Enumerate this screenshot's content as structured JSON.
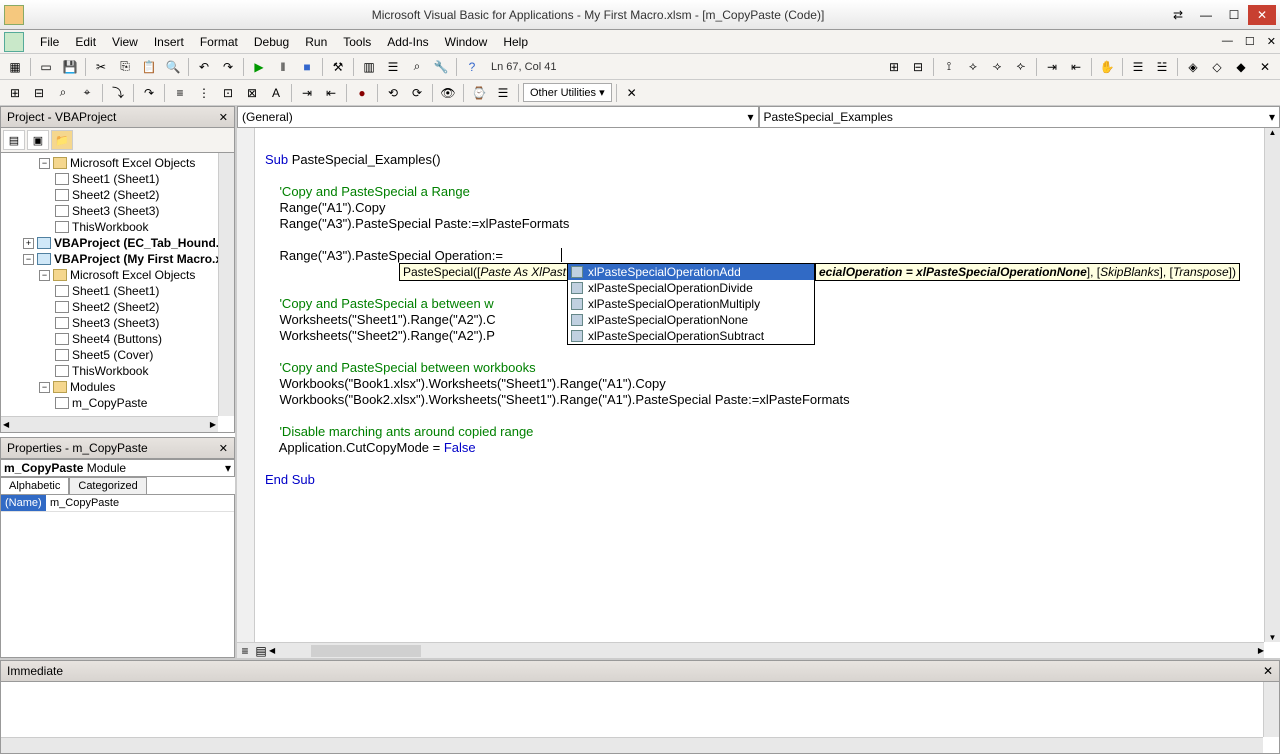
{
  "title": "Microsoft Visual Basic for Applications - My First Macro.xlsm - [m_CopyPaste (Code)]",
  "menu": [
    "File",
    "Edit",
    "View",
    "Insert",
    "Format",
    "Debug",
    "Run",
    "Tools",
    "Add-Ins",
    "Window",
    "Help"
  ],
  "status_line": "Ln 67, Col 41",
  "other_utilities": "Other Utilities",
  "project_panel_title": "Project - VBAProject",
  "tree": {
    "excel_objects": "Microsoft Excel Objects",
    "sheet1": "Sheet1 (Sheet1)",
    "sheet2": "Sheet2 (Sheet2)",
    "sheet3": "Sheet3 (Sheet3)",
    "thisworkbook": "ThisWorkbook",
    "vbaproj_ec": "VBAProject (EC_Tab_Hound.x",
    "vbaproj_my": "VBAProject (My First Macro.x",
    "sheet4": "Sheet4 (Buttons)",
    "sheet5": "Sheet5 (Cover)",
    "modules": "Modules",
    "m_copypaste": "m_CopyPaste"
  },
  "properties_panel_title": "Properties - m_CopyPaste",
  "prop_combo_label": "m_CopyPaste",
  "prop_combo_type": "Module",
  "prop_tabs": [
    "Alphabetic",
    "Categorized"
  ],
  "prop_name": "(Name)",
  "prop_val": "m_CopyPaste",
  "code_dd1": "(General)",
  "code_dd2": "PasteSpecial_Examples",
  "code_lines": [
    "",
    "Sub PasteSpecial_Examples()",
    "",
    "    'Copy and PasteSpecial a Range",
    "    Range(\"A1\").Copy",
    "    Range(\"A3\").PasteSpecial Paste:=xlPasteFormats",
    "",
    "    Range(\"A3\").PasteSpecial Operation:=",
    "",
    "",
    "    'Copy and PasteSpecial a between w",
    "    Worksheets(\"Sheet1\").Range(\"A2\").C",
    "    Worksheets(\"Sheet2\").Range(\"A2\").P                     las",
    "",
    "    'Copy and PasteSpecial between workbooks",
    "    Workbooks(\"Book1.xlsx\").Worksheets(\"Sheet1\").Range(\"A1\").Copy",
    "    Workbooks(\"Book2.xlsx\").Worksheets(\"Sheet1\").Range(\"A1\").PasteSpecial Paste:=xlPasteFormats",
    "",
    "    'Disable marching ants around copied range",
    "    Application.CutCopyMode = False",
    "",
    "End Sub"
  ],
  "tooltip_prefix": "PasteSpecial([",
  "tooltip_paste": "Paste As XlPast",
  "tooltip_op": "ecialOperation = xlPasteSpecialOperationNone",
  "tooltip_skip": "SkipBlanks",
  "tooltip_trans": "Transpose",
  "intellisense": {
    "selected": "xlPasteSpecialOperationAdd",
    "items": [
      "xlPasteSpecialOperationDivide",
      "xlPasteSpecialOperationMultiply",
      "xlPasteSpecialOperationNone",
      "xlPasteSpecialOperationSubtract"
    ]
  },
  "immediate_title": "Immediate"
}
